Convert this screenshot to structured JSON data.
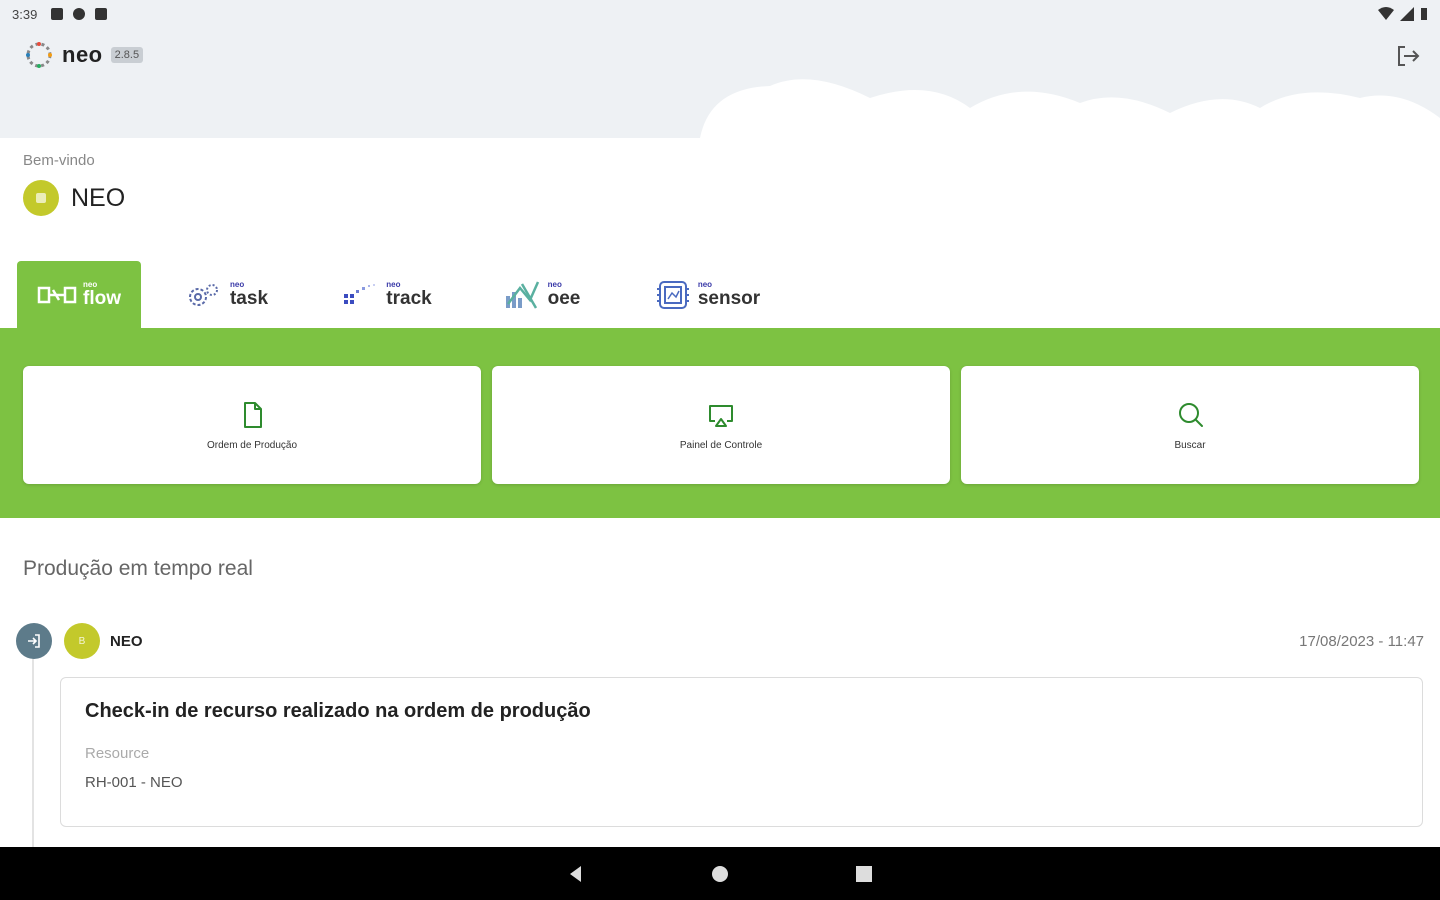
{
  "status_bar": {
    "time": "3:39"
  },
  "header": {
    "brand_name": "neo",
    "brand_version": "2.8.5"
  },
  "welcome": {
    "label": "Bem-vindo",
    "user_name": "NEO"
  },
  "tabs": [
    {
      "prefix": "neo",
      "label": "flow",
      "icon": "flow-icon",
      "active": true
    },
    {
      "prefix": "neo",
      "label": "task",
      "icon": "gears-icon",
      "active": false
    },
    {
      "prefix": "neo",
      "label": "track",
      "icon": "track-icon",
      "active": false
    },
    {
      "prefix": "neo",
      "label": "oee",
      "icon": "oee-chart-icon",
      "active": false
    },
    {
      "prefix": "neo",
      "label": "sensor",
      "icon": "sensor-chip-icon",
      "active": false
    }
  ],
  "actions": [
    {
      "label": "Ordem de Produção",
      "icon": "document-icon"
    },
    {
      "label": "Painel de Controle",
      "icon": "cast-screen-icon"
    },
    {
      "label": "Buscar",
      "icon": "search-icon"
    }
  ],
  "feed": {
    "title": "Produção em tempo real",
    "events": [
      {
        "avatar_initials": "B",
        "user": "NEO",
        "date": "17/08/2023 - 11:47",
        "title": "Check-in de recurso realizado na ordem de produção",
        "field_label": "Resource",
        "field_value": "RH-001 - NEO"
      }
    ]
  },
  "colors": {
    "primary_green": "#7dc242",
    "avatar_olive": "#c3c92b",
    "event_icon_slate": "#5d7b8a",
    "header_bg": "#eef1f4"
  }
}
